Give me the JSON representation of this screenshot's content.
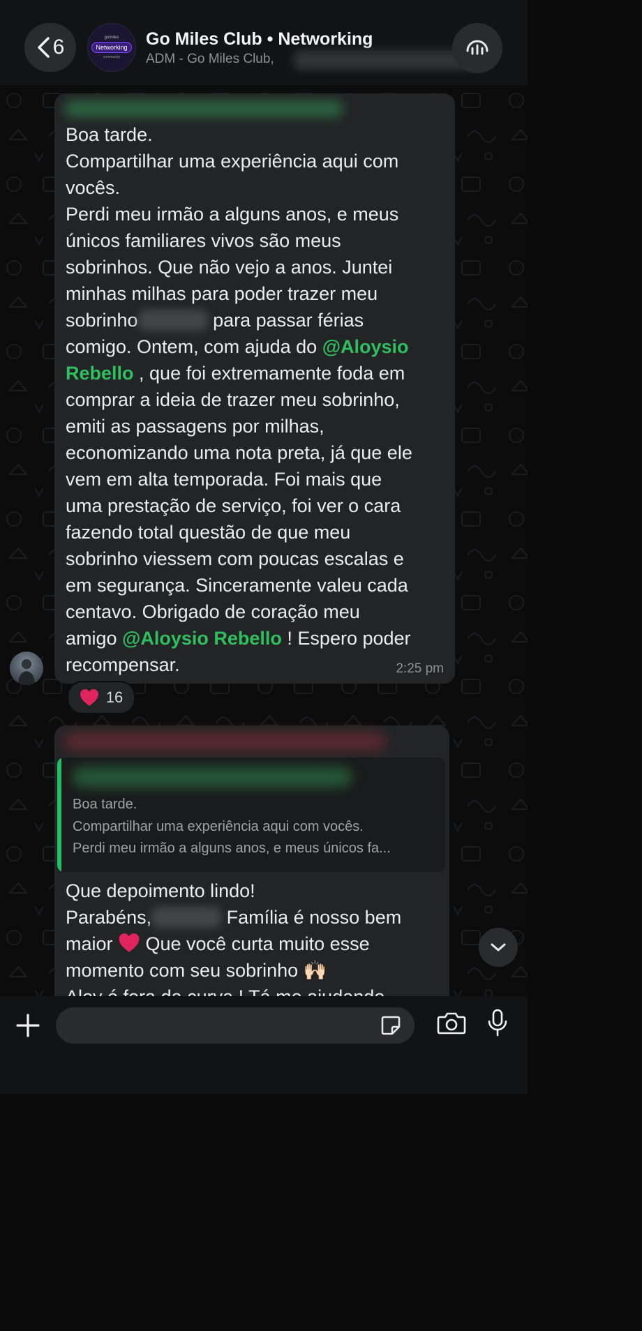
{
  "header": {
    "back_count": "6",
    "avatar_top": "gomiles",
    "avatar_pill": "Networking",
    "avatar_bottom": "community",
    "title": "Go Miles Club • Networking",
    "subtitle": "ADM - Go Miles Club,"
  },
  "message1": {
    "lines": [
      "Boa tarde.",
      "Compartilhar uma experiência aqui com",
      "vocês.",
      "Perdi meu irmão a alguns anos, e meus",
      "únicos familiares vivos são meus",
      "sobrinhos. Que não vejo a anos. Juntei",
      "minhas milhas para poder trazer meu"
    ],
    "line8_before": "sobrinho",
    "line8_after": " para passar férias",
    "line9_before": "comigo. Ontem, com ajuda do ",
    "mention_part1": "@Aloysio",
    "mention_part2": "Rebello",
    "line10_after": " , que foi extremamente foda em",
    "lines_b": [
      "comprar a ideia de trazer meu sobrinho,",
      "emiti as passagens por milhas,",
      "economizando uma nota preta, já que ele",
      "vem em alta temporada. Foi mais que",
      "uma prestação de serviço, foi ver o cara",
      "fazendo total questão de que meu",
      "sobrinho viessem com poucas escalas e",
      "em segurança. Sinceramente valeu cada",
      "centavo. Obrigado de coração meu"
    ],
    "line20_before": "amigo ",
    "mention_full": "@Aloysio Rebello",
    "line20_after": " ! Espero poder",
    "last_line": "recompensar.",
    "time": "2:25 pm"
  },
  "reaction": {
    "emoji": "heart-icon",
    "count": "16"
  },
  "message2": {
    "quote_lines": [
      "Boa tarde.",
      "Compartilhar uma experiência aqui com vocês.",
      "Perdi meu irmão a alguns anos, e meus únicos fa..."
    ],
    "line1": "Que depoimento lindo!",
    "line2_before": "Parabéns,",
    "line2_after": " Família é nosso bem",
    "line3_before": "maior ",
    "line3_after": " Que você curta muito esse",
    "line4": "momento com seu sobrinho 🙌🏻",
    "line5": "Aloy é fora da curva ! Tá me ajudando"
  },
  "colors": {
    "accent_green": "#2fbf5e",
    "bubble": "#232426",
    "background": "#0c0c0d",
    "heart": "#e0245e"
  }
}
